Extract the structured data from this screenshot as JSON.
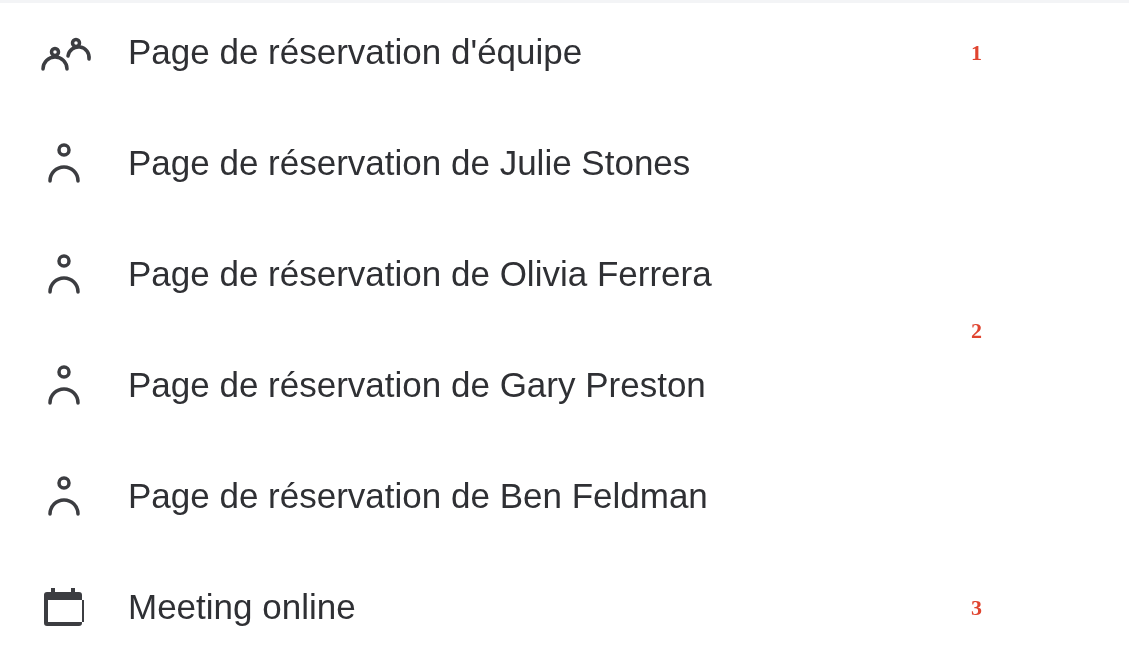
{
  "groups": [
    {
      "marker": "1",
      "items": [
        {
          "kind": "team",
          "label": "Page de réservation d'équipe"
        }
      ]
    },
    {
      "marker": "2",
      "items": [
        {
          "kind": "person",
          "label": "Page de réservation de Julie Stones"
        },
        {
          "kind": "person",
          "label": "Page de réservation de Olivia Ferrera"
        },
        {
          "kind": "person",
          "label": "Page de réservation de Gary Preston"
        },
        {
          "kind": "person",
          "label": "Page de réservation de Ben Feldman"
        }
      ]
    },
    {
      "marker": "3",
      "items": [
        {
          "kind": "calendar",
          "label": "Meeting online"
        }
      ]
    }
  ]
}
